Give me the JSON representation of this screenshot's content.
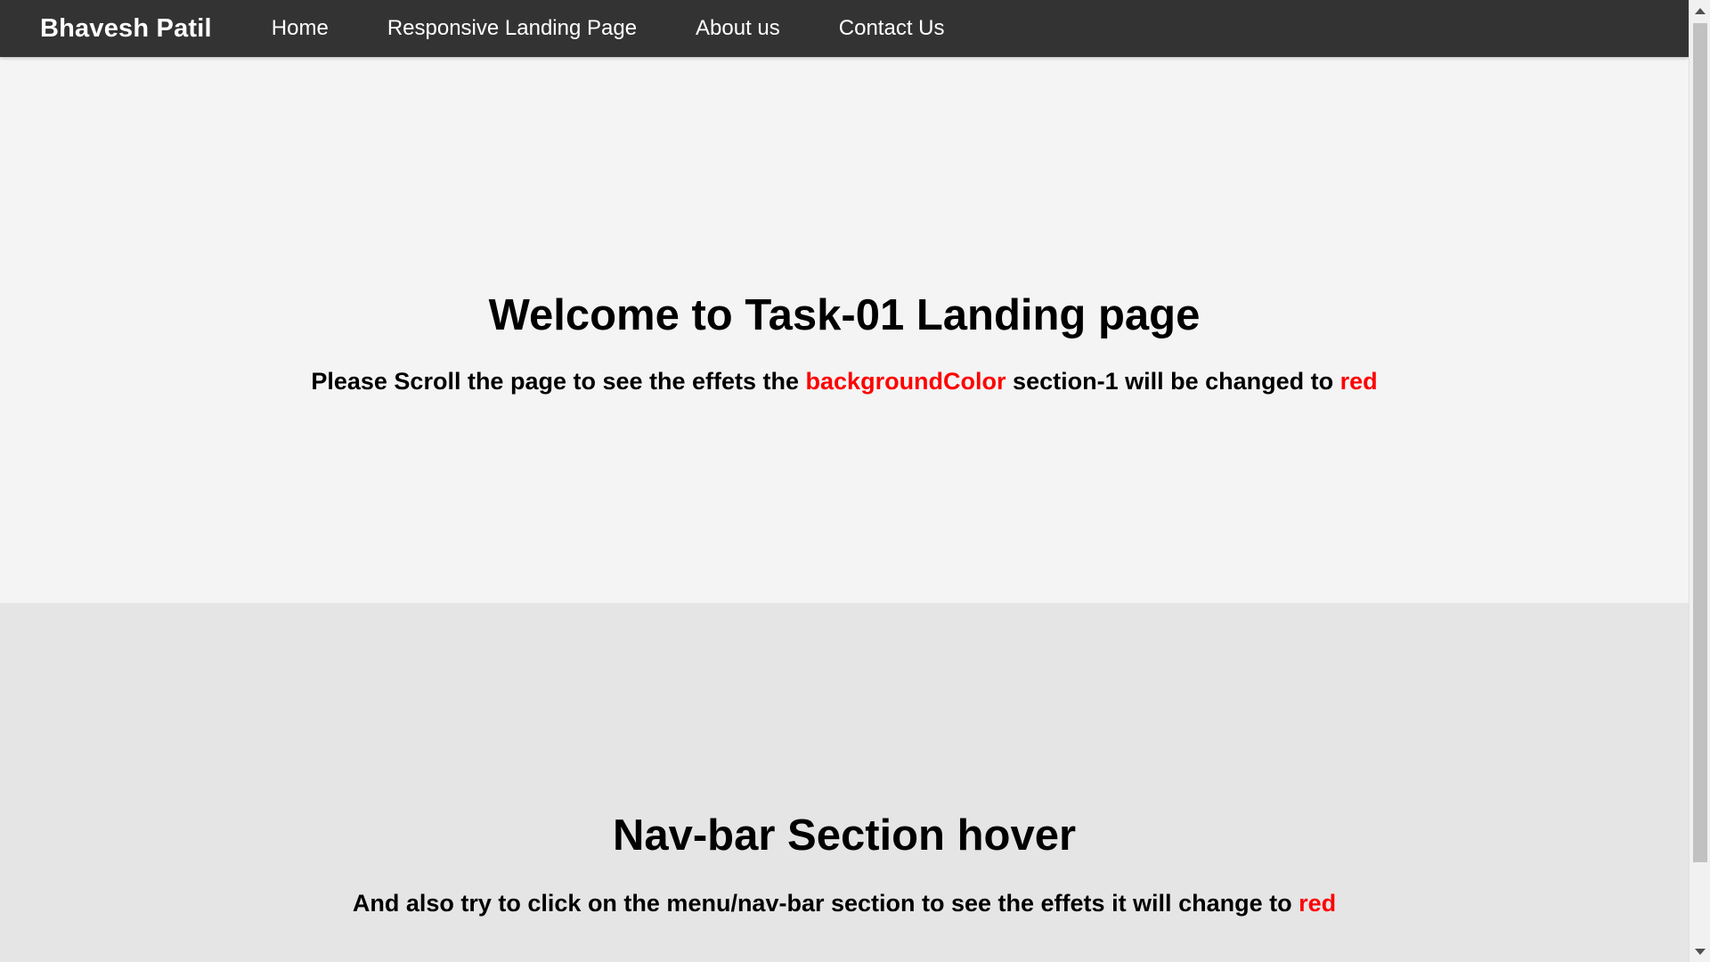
{
  "navbar": {
    "brand": "Bhavesh Patil",
    "links": [
      {
        "label": "Home"
      },
      {
        "label": "Responsive Landing Page"
      },
      {
        "label": "About us"
      },
      {
        "label": "Contact Us"
      }
    ]
  },
  "section1": {
    "title": "Welcome to Task-01 Landing page",
    "text_part1": "Please Scroll the page to see the effets the ",
    "text_highlight1": "backgroundColor",
    "text_part2": " section-1 will be changed to ",
    "text_highlight2": "red"
  },
  "section2": {
    "title": "Nav-bar Section hover",
    "text_part1": "And also try to click on the menu/nav-bar section to see the effets it will change to ",
    "text_highlight1": "red"
  },
  "colors": {
    "navbar_bg": "#333333",
    "section1_bg": "#f4f4f4",
    "section2_bg": "#e5e5e5",
    "highlight": "#ff0000"
  },
  "scrollbar": {
    "position_fraction": 0.0
  }
}
